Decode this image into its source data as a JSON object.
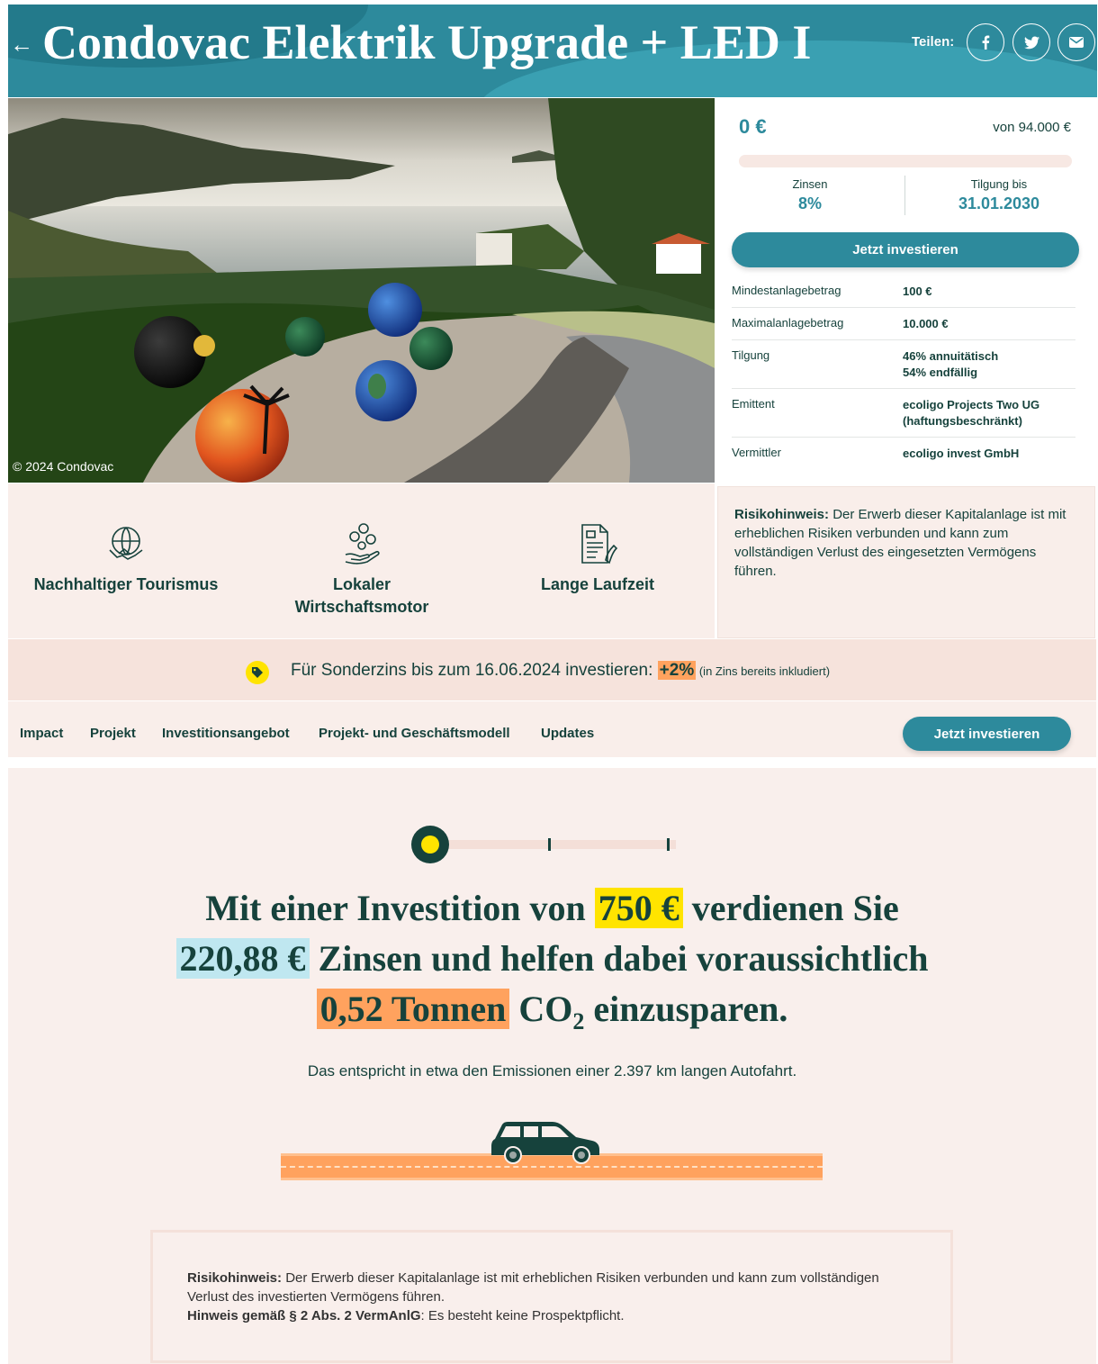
{
  "header": {
    "back_icon": "arrow-left-icon",
    "title": "Condovac Elektrik Upgrade + LED I",
    "share_label": "Teilen:",
    "share_icons": [
      "facebook-icon",
      "twitter-icon",
      "mail-icon"
    ]
  },
  "hero": {
    "caption": "© 2024 Condovac"
  },
  "panel": {
    "amount": "0 €",
    "goal": "von 94.000 €",
    "progress": 0,
    "interest_label": "Zinsen",
    "interest_value": "8%",
    "repayment_label": "Tilgung bis",
    "repayment_value": "31.01.2030",
    "cta": "Jetzt investieren",
    "details": [
      {
        "key": "Mindestanlagebetrag",
        "value": "100 €"
      },
      {
        "key": "Maximalanlagebetrag",
        "value": "10.000 €"
      },
      {
        "key": "Tilgung",
        "value": "46% annuitätisch",
        "value2": "54% endfällig"
      },
      {
        "key": "Emittent",
        "value": "ecoligo Projects Two UG",
        "value2": "(haftungsbeschränkt)"
      },
      {
        "key": "Vermittler",
        "value": "ecoligo invest GmbH"
      }
    ]
  },
  "features": [
    {
      "icon": "handshake-globe-icon",
      "label": "Nachhaltiger Tourismus"
    },
    {
      "icon": "hand-coins-icon",
      "label1": "Lokaler",
      "label2": "Wirtschaftsmotor"
    },
    {
      "icon": "contract-signature-icon",
      "label": "Lange Laufzeit"
    }
  ],
  "risk_notice": {
    "title": "Risikohinweis:",
    "text": " Der Erwerb dieser Kapitalanlage ist mit erheblichen Risiken verbunden und kann zum vollständigen Verlust des eingesetzten Vermögens führen."
  },
  "promo": {
    "icon": "tag-icon",
    "text": "Für Sonderzins bis zum 16.06.2024 investieren: ",
    "bonus": "+2%",
    "note": " (in Zins bereits inkludiert)"
  },
  "nav": {
    "items": [
      "Impact",
      "Projekt",
      "Investitionsangebot",
      "Projekt- und Geschäftsmodell",
      "Updates"
    ],
    "cta": "Jetzt investieren"
  },
  "impact": {
    "slider_position": 0,
    "line1_a": "Mit einer Investition von ",
    "investment": "750 €",
    "line1_b": " verdienen Sie",
    "interest": "220,88 €",
    "line2_b": " Zinsen und helfen dabei voraussichtlich",
    "co2_amount": "0,52 Tonnen",
    "line3_b_pre": " CO",
    "line3_sub": "2",
    "line3_b_post": " einzusparen.",
    "equivalent": "Das entspricht in etwa den Emissionen einer 2.397 km langen Autofahrt.",
    "car_icon": "car-icon"
  },
  "footer_risk": {
    "title": "Risikohinweis:",
    "text": " Der Erwerb dieser Kapitalanlage ist mit erheblichen Risiken verbunden und kann zum vollständigen Verlust des investierten Vermögens führen.",
    "hint_title": "Hinweis gemäß § 2 Abs. 2 VermAnlG",
    "hint_text": ": Es besteht keine Prospektpflicht."
  },
  "colors": {
    "brand": "#2d8a9c",
    "dark": "#16423c",
    "yellow": "#ffe400",
    "orange": "#ffa25e",
    "light_blue": "#bfe7f0"
  }
}
